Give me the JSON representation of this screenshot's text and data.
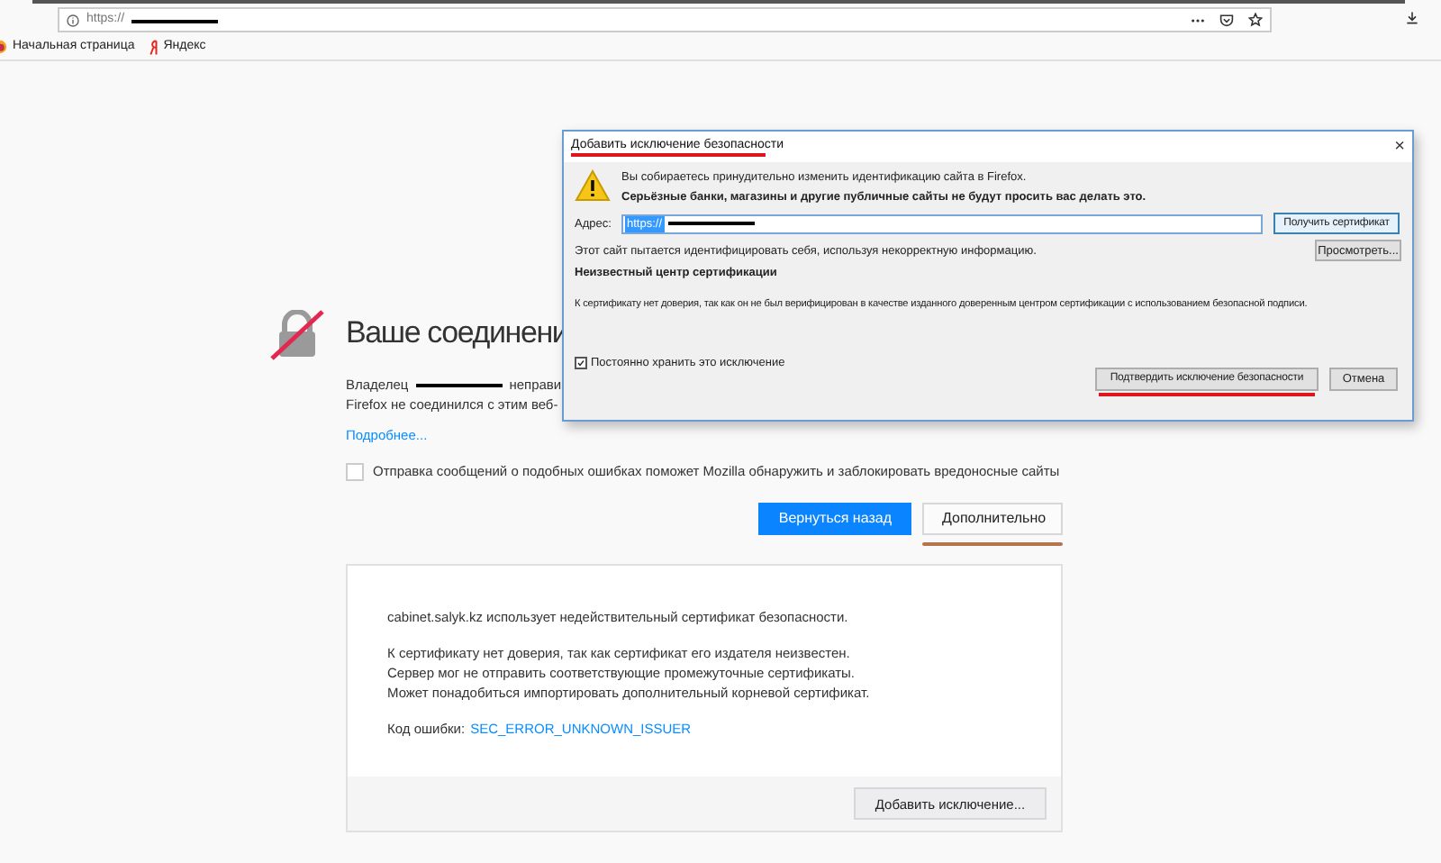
{
  "toolbar": {
    "url": "https://"
  },
  "bookmarks": [
    {
      "label": "Начальная страница",
      "kind": "firefox"
    },
    {
      "label": "Яндекс",
      "kind": "yandex"
    }
  ],
  "page": {
    "heading": "Ваше соединени",
    "owner_label": "Владелец",
    "owner_after": "неправи",
    "line2": "Firefox не соединился с этим веб-",
    "learn_more": "Подробнее...",
    "report": {
      "label": "Отправка сообщений о подобных ошибках поможет Mozilla обнаружить и заблокировать вредоносные сайты",
      "checked": false
    },
    "buttons": [
      {
        "label": "Вернуться назад",
        "kind": "primary"
      },
      {
        "label": "Дополнительно",
        "kind": "secondary",
        "underlined": true
      }
    ],
    "advanced": {
      "paragraphs": [
        "cabinet.salyk.kz использует недействительный сертификат безопасности.",
        "К сертификату нет доверия, так как сертификат его издателя неизвестен.\nСервер мог не отправить соответствующие промежуточные сертификаты.\nМожет понадобиться импортировать дополнительный корневой сертификат."
      ],
      "error_label": "Код ошибки:",
      "error_code": "SEC_ERROR_UNKNOWN_ISSUER",
      "button": "Добавить исключение..."
    }
  },
  "dialog": {
    "title": "Добавить исключение безопасности",
    "close": "×",
    "warning": "Вы собираетесь принудительно изменить идентификацию сайта в Firefox.",
    "warning_bold": "Серьёзные банки, магазины и другие публичные сайты не будут просить вас делать это.",
    "address_label": "Адрес:",
    "address_value": "https://",
    "get_button": "Получить сертификат",
    "view_button": "Просмотреть...",
    "status": "Этот сайт пытается идентифицировать себя, используя некорректную информацию.",
    "section": "Неизвестный центр сертификации",
    "description": "К сертификату нет доверия, так как он не был верифицирован в качестве изданного доверенным центром сертификации с использованием безопасной подписи.",
    "permanent": {
      "label": "Постоянно хранить это исключение",
      "checked": true
    },
    "confirm": {
      "label": "Подтвердить исключение безопасности",
      "underlined": true
    },
    "cancel": "Отмена"
  }
}
